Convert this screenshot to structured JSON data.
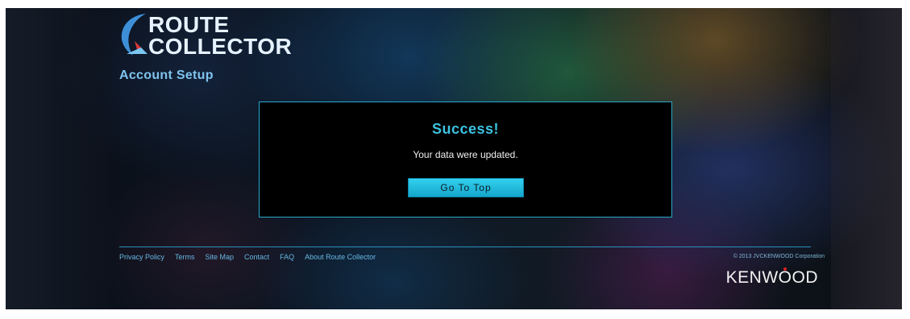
{
  "brand": {
    "logo_line1": "ROUTE",
    "logo_line2": "COLLECTOR",
    "footer_brand_prefix": "KENW",
    "footer_brand_dot_letter": "O",
    "footer_brand_suffix": "OD"
  },
  "page": {
    "title": "Account Setup"
  },
  "dialog": {
    "heading": "Success!",
    "message": "Your data were updated.",
    "button_label": "Go To Top"
  },
  "footer": {
    "links": [
      "Privacy Policy",
      "Terms",
      "Site Map",
      "Contact",
      "FAQ",
      "About Route Collector"
    ],
    "copyright": "© 2013 JVCKENWOOD Corporation"
  },
  "colors": {
    "accent": "#3cc2e0",
    "button": "#22bde0",
    "link": "#67b8e3",
    "brand_red": "#e02020"
  }
}
